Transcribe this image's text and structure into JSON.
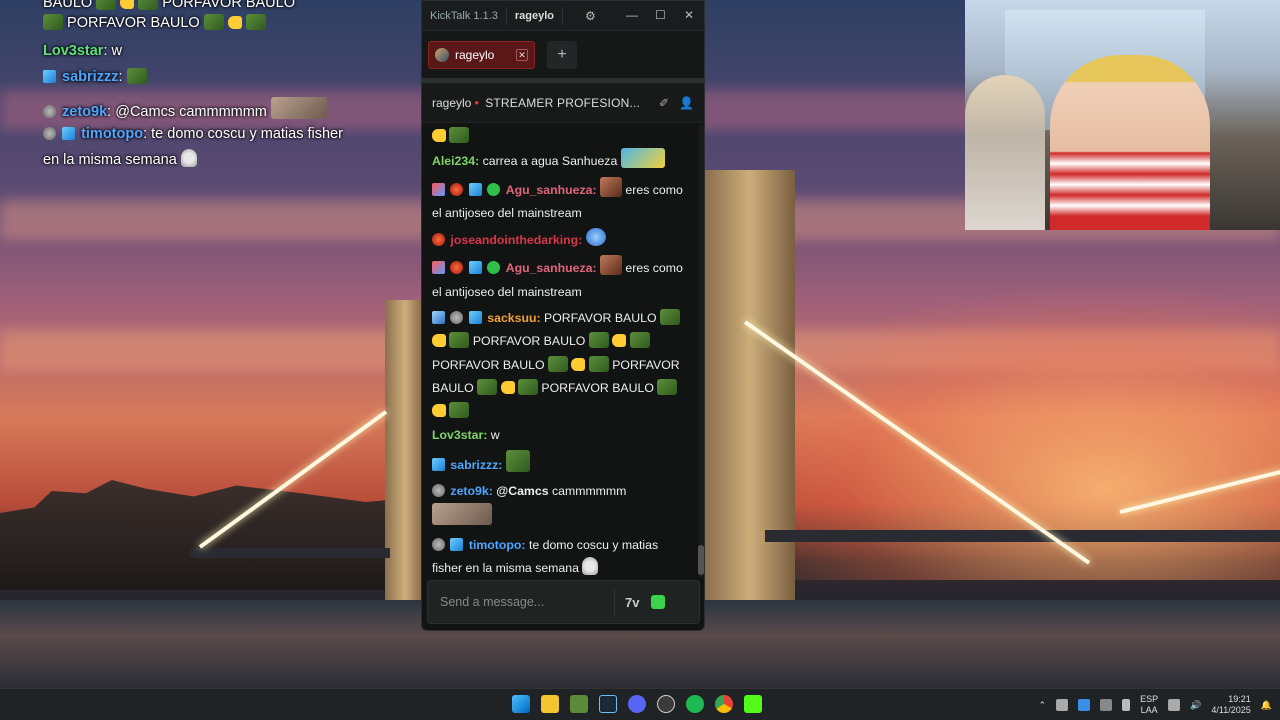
{
  "overlay": {
    "line0": "BAULO",
    "line0b": "PORFAVOR BAULO",
    "line1": "PORFAVOR BAULO",
    "line2_user": "Lov3star",
    "line2_text": "w",
    "line3_user": "sabrizzz",
    "line4_user": "zeto9k",
    "line4_text": "@Camcs cammmmmm",
    "line5_user": "timotopo",
    "line5_text": "te domo coscu y matias fisher",
    "line6_text": "en la misma semana"
  },
  "app": {
    "title": "KickTalk 1.1.3",
    "channel": "rageylo",
    "tab_label": "rageylo",
    "add_tab": "+",
    "header_channel": "rageylo",
    "header_title": "STREAMER PROFESION...",
    "input_placeholder": "Send a message...",
    "input_value": "",
    "seven_tv_label": "7v"
  },
  "chat": {
    "messages": [
      {
        "user": "",
        "text": ""
      },
      {
        "user": "Alei234:",
        "text": "carrea a agua Sanhueza",
        "color": "#7fd36b"
      },
      {
        "user": "Agu_sanhueza:",
        "text": "eres como el antijoseo del mainstream",
        "color": "#e0657a"
      },
      {
        "user": "joseandointhedarking:",
        "text": "",
        "color": "#d9364a"
      },
      {
        "user": "Agu_sanhueza:",
        "text": "eres como el antijoseo del mainstream",
        "color": "#e0657a"
      },
      {
        "user": "sacksuu:",
        "text": "PORFAVOR BAULO",
        "color": "#f2a13a"
      },
      {
        "user": "",
        "text": "PORFAVOR BAULO"
      },
      {
        "user": "",
        "text": "PORFAVOR BAULO"
      },
      {
        "user": "",
        "text": "PORFAVOR"
      },
      {
        "user": "",
        "text": "BAULO"
      },
      {
        "user": "",
        "text": "PORFAVOR BAULO"
      },
      {
        "user": "Lov3star:",
        "text": "w",
        "color": "#7fd36b"
      },
      {
        "user": "sabrizzz:",
        "text": "",
        "color": "#4fa6ff"
      },
      {
        "user": "zeto9k:",
        "text": "@Camcs",
        "text2": "cammmmmm",
        "color": "#4fa6ff"
      },
      {
        "user": "timotopo:",
        "text": "te domo coscu y matias fisher en la misma semana",
        "color": "#4fa6ff"
      }
    ]
  },
  "taskbar": {
    "lang_top": "ESP",
    "lang_bottom": "LAA",
    "time": "19:21",
    "date": "4/11/2025"
  }
}
